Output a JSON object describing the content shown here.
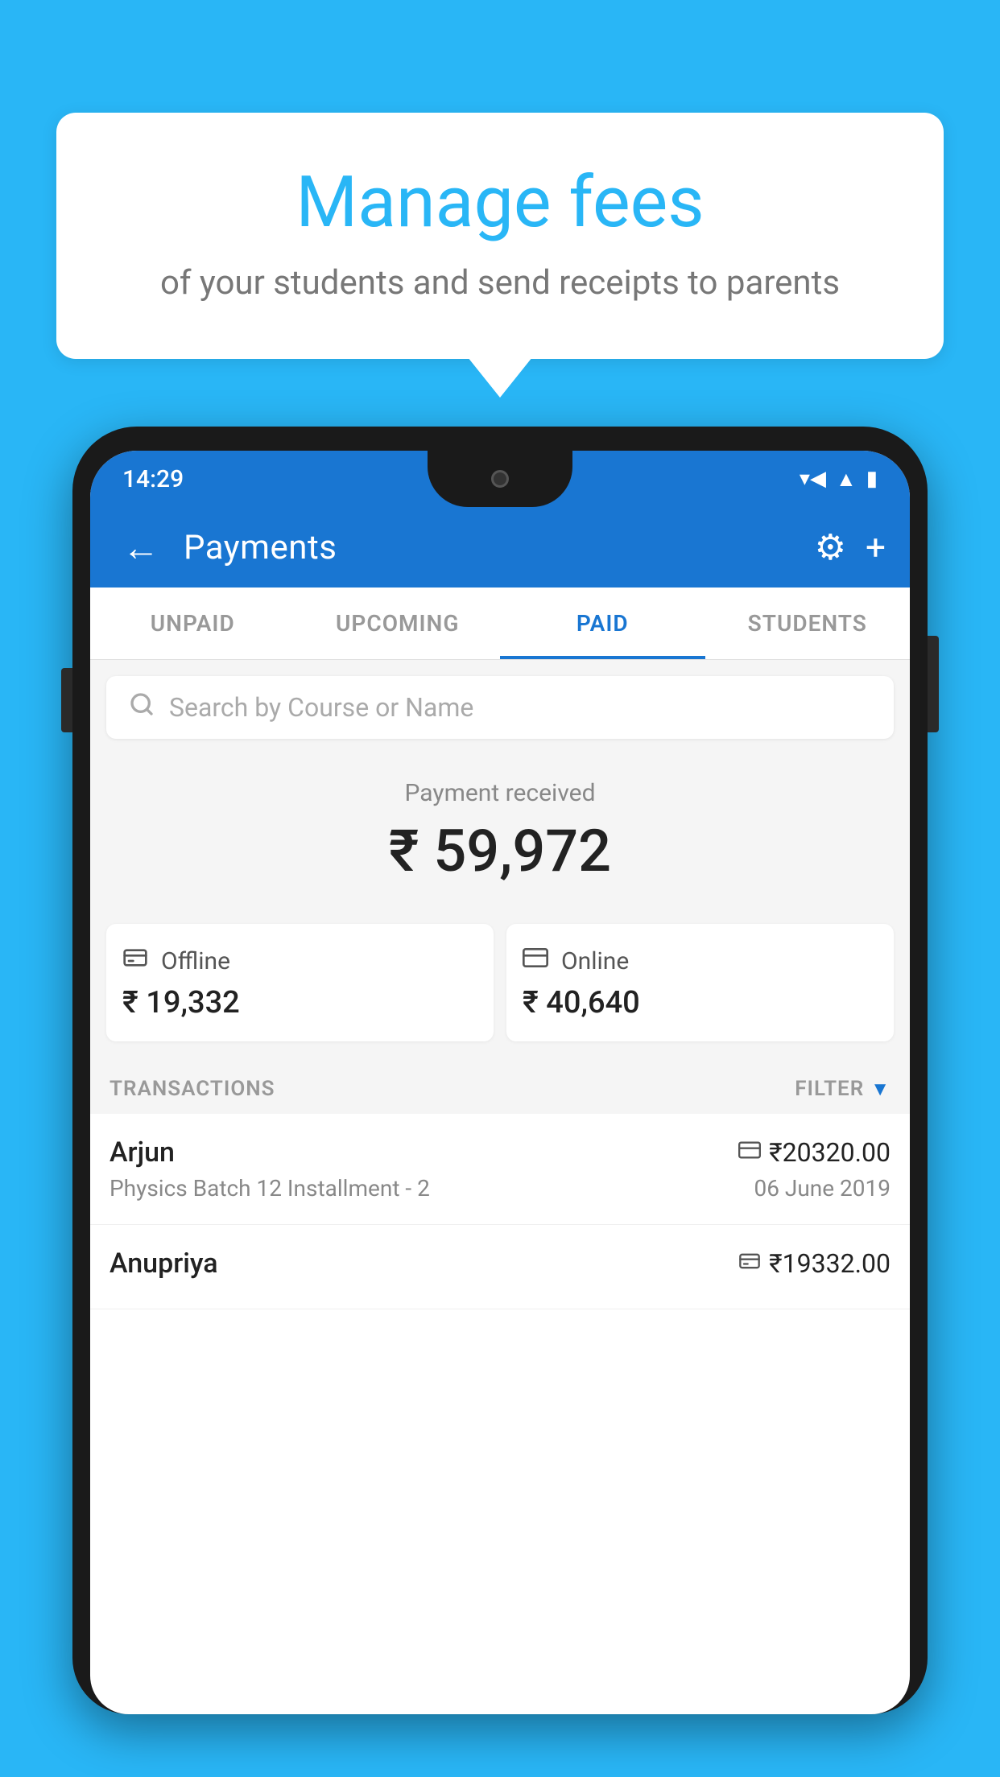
{
  "background_color": "#29B6F6",
  "speech_bubble": {
    "title": "Manage fees",
    "subtitle": "of your students and send receipts to parents"
  },
  "phone": {
    "status_bar": {
      "time": "14:29",
      "wifi": "▼",
      "signal": "▲",
      "battery": "▮"
    },
    "app_bar": {
      "back_label": "←",
      "title": "Payments",
      "gear_label": "⚙",
      "plus_label": "+"
    },
    "tabs": [
      {
        "label": "UNPAID",
        "active": false
      },
      {
        "label": "UPCOMING",
        "active": false
      },
      {
        "label": "PAID",
        "active": true
      },
      {
        "label": "STUDENTS",
        "active": false
      }
    ],
    "search": {
      "placeholder": "Search by Course or Name"
    },
    "payment_summary": {
      "label": "Payment received",
      "amount": "₹ 59,972",
      "offline": {
        "label": "Offline",
        "amount": "₹ 19,332"
      },
      "online": {
        "label": "Online",
        "amount": "₹ 40,640"
      }
    },
    "transactions": {
      "header_label": "TRANSACTIONS",
      "filter_label": "FILTER",
      "items": [
        {
          "name": "Arjun",
          "amount": "₹20320.00",
          "course": "Physics Batch 12 Installment - 2",
          "date": "06 June 2019",
          "payment_type": "card"
        },
        {
          "name": "Anupriya",
          "amount": "₹19332.00",
          "course": "",
          "date": "",
          "payment_type": "offline"
        }
      ]
    }
  }
}
